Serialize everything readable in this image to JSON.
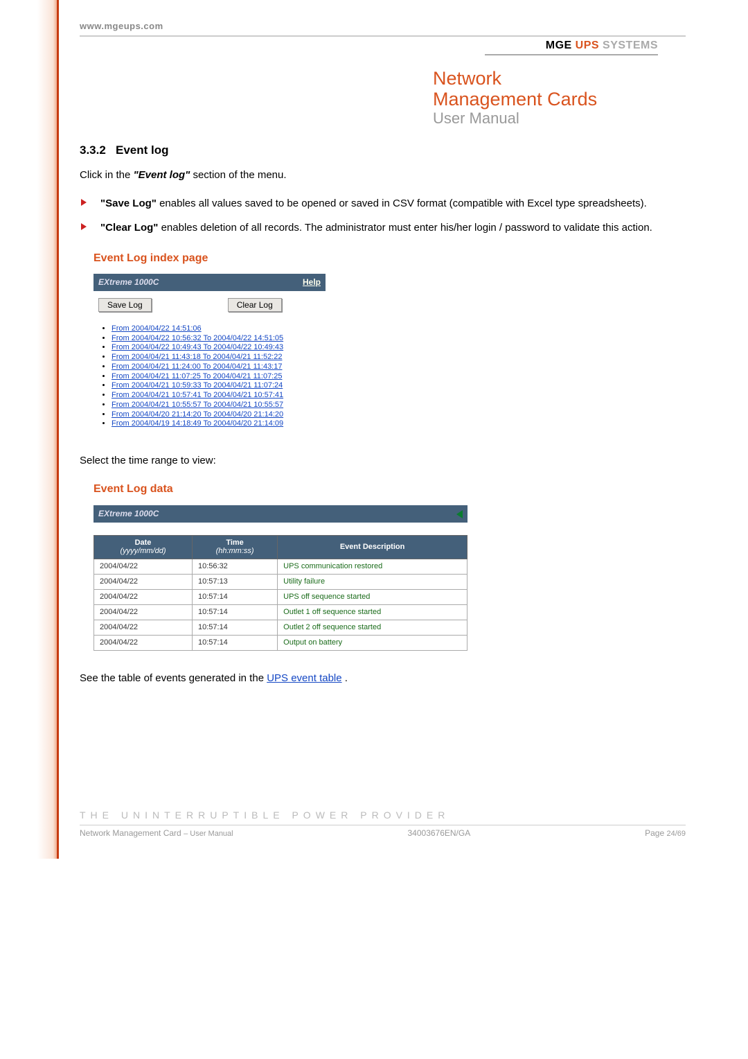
{
  "header": {
    "url": "www.mgeups.com",
    "brand_mge": "MGE",
    "brand_ups": "UPS",
    "brand_sys": "SYSTEMS",
    "title1": "Network",
    "title2": "Management Cards",
    "subtitle": "User Manual"
  },
  "content": {
    "section_num": "3.3.2",
    "section_title": "Event log",
    "intro_pre": "Click in the ",
    "intro_em": "\"Event log\"",
    "intro_post": " section of the menu.",
    "bullet1_b": "\"Save Log\"",
    "bullet1_t": " enables all values saved to be opened or saved in CSV format (compatible with Excel type spreadsheets).",
    "bullet2_b": "\"Clear Log\"",
    "bullet2_t": " enables deletion of all records. The administrator must enter his/her login / password to validate this action.",
    "index_title": "Event Log index page",
    "device": "EXtreme 1000C",
    "help": "Help",
    "save_btn": "Save Log",
    "clear_btn": "Clear Log",
    "log_links": [
      "From 2004/04/22 14:51:06",
      "From 2004/04/22 10:56:32 To 2004/04/22 14:51:05",
      "From 2004/04/22 10:49:43 To 2004/04/22 10:49:43",
      "From 2004/04/21 11:43:18 To 2004/04/21 11:52:22",
      "From 2004/04/21 11:24:00 To 2004/04/21 11:43:17",
      "From 2004/04/21 11:07:25 To 2004/04/21 11:07:25",
      "From 2004/04/21 10:59:33 To 2004/04/21 11:07:24",
      "From 2004/04/21 10:57:41 To 2004/04/21 10:57:41",
      "From 2004/04/21 10:55:57 To 2004/04/21 10:55:57",
      "From 2004/04/20 21:14:20 To 2004/04/20 21:14:20",
      "From 2004/04/19 14:18:49 To 2004/04/20 21:14:09"
    ],
    "select_range": "Select the time range to view:",
    "data_title": "Event Log data",
    "col_date": "Date",
    "col_date_sub": "(yyyy/mm/dd)",
    "col_time": "Time",
    "col_time_sub": "(hh:mm:ss)",
    "col_desc": "Event Description",
    "rows": [
      {
        "d": "2004/04/22",
        "t": "10:56:32",
        "e": "UPS communication restored"
      },
      {
        "d": "2004/04/22",
        "t": "10:57:13",
        "e": "Utility failure"
      },
      {
        "d": "2004/04/22",
        "t": "10:57:14",
        "e": "UPS off sequence started"
      },
      {
        "d": "2004/04/22",
        "t": "10:57:14",
        "e": "Outlet 1 off sequence started"
      },
      {
        "d": "2004/04/22",
        "t": "10:57:14",
        "e": "Outlet 2 off sequence started"
      },
      {
        "d": "2004/04/22",
        "t": "10:57:14",
        "e": "Output on battery"
      }
    ],
    "see_pre": "See the table of events generated in the ",
    "see_link": "UPS event table",
    "see_post": "."
  },
  "footer": {
    "tag": "THE UNINTERRUPTIBLE POWER PROVIDER",
    "left_a": "Network Management Card",
    "left_b": " – User Manual",
    "mid": "34003676EN/GA",
    "right_a": "Page ",
    "right_b": "24/69"
  }
}
